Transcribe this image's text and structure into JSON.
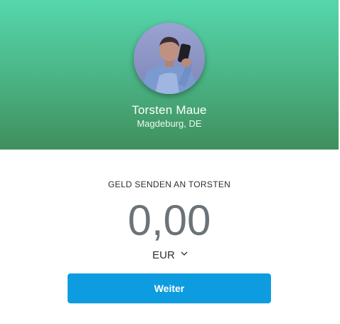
{
  "profile": {
    "name": "Torsten Maue",
    "location": "Magdeburg, DE",
    "avatar_icon": "profile-photo"
  },
  "send": {
    "label": "GELD SENDEN AN TORSTEN",
    "amount": "0,00",
    "currency": "EUR",
    "currency_icon": "chevron-down-icon"
  },
  "actions": {
    "continue_label": "Weiter"
  },
  "colors": {
    "hero_top": "#56d6ad",
    "hero_bottom": "#3f8f5c",
    "button": "#0e9ce0",
    "amount_text": "#6c7378"
  }
}
